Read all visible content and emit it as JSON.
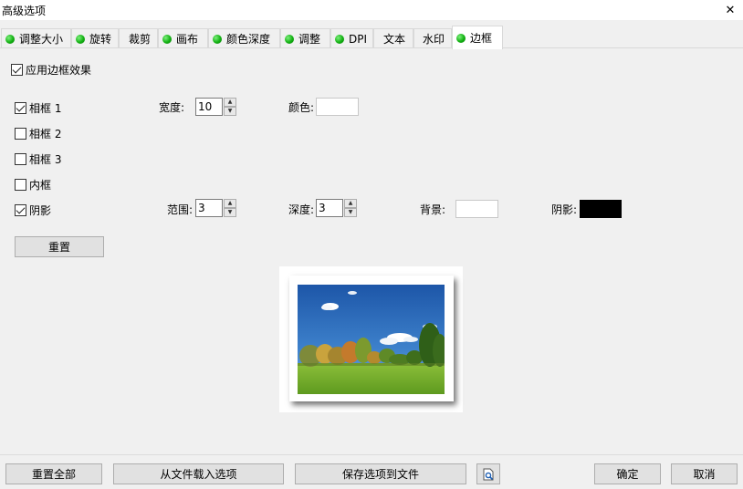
{
  "window": {
    "title": "高级选项",
    "close_glyph": "✕"
  },
  "tabs": [
    {
      "label": "调整大小",
      "has_dot": true
    },
    {
      "label": "旋转",
      "has_dot": true
    },
    {
      "label": "裁剪",
      "has_dot": false
    },
    {
      "label": "画布",
      "has_dot": true
    },
    {
      "label": "颜色深度",
      "has_dot": true
    },
    {
      "label": "调整",
      "has_dot": true
    },
    {
      "label": "DPI",
      "has_dot": true
    },
    {
      "label": "文本",
      "has_dot": false
    },
    {
      "label": "水印",
      "has_dot": false
    },
    {
      "label": "边框",
      "has_dot": true,
      "active": true
    }
  ],
  "colors": {
    "dot": "#12b012",
    "shadow_color": "#000000",
    "frame_color": "#ffffff",
    "background_color": "#ffffff"
  },
  "border": {
    "apply_label": "应用边框效果",
    "apply_checked": true,
    "frame1": {
      "label": "相框 1",
      "checked": true
    },
    "frame2": {
      "label": "相框 2",
      "checked": false
    },
    "frame3": {
      "label": "相框 3",
      "checked": false
    },
    "inner": {
      "label": "内框",
      "checked": false
    },
    "shadow": {
      "label": "阴影",
      "checked": true
    },
    "width_label": "宽度:",
    "width_value": "10",
    "color_label": "颜色:",
    "range_label": "范围:",
    "range_value": "3",
    "depth_label": "深度:",
    "depth_value": "3",
    "background_label": "背景:",
    "shadow_color_label": "阴影:",
    "reset_label": "重置"
  },
  "footer": {
    "reset_all": "重置全部",
    "load": "从文件载入选项",
    "save": "保存选项到文件",
    "preview_icon": "preview-search-icon",
    "ok": "确定",
    "cancel": "取消"
  }
}
